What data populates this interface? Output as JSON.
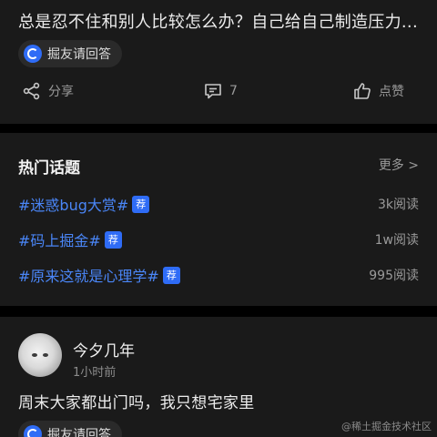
{
  "post1": {
    "title": "总是忍不住和别人比较怎么办？自己给自己制造压力...",
    "answer_button": "掘友请回答",
    "actions": {
      "share": "分享",
      "comments": "7",
      "like": "点赞"
    }
  },
  "hot_topics": {
    "title": "热门话题",
    "more": "更多 >",
    "items": [
      {
        "name": "#迷惑bug大赏#",
        "badge": "荐",
        "reads": "3k阅读"
      },
      {
        "name": "#码上掘金#",
        "badge": "荐",
        "reads": "1w阅读"
      },
      {
        "name": "#原来这就是心理学#",
        "badge": "荐",
        "reads": "995阅读"
      }
    ]
  },
  "post2": {
    "username": "今夕几年",
    "time": "1小时前",
    "text": "周末大家都出门吗，我只想宅家里",
    "answer_button": "掘友请回答"
  },
  "watermark": "@稀土掘金技术社区",
  "colors": {
    "accent": "#2f6cf6",
    "topic_link": "#4a86f7",
    "card_bg": "#1a1a1a"
  }
}
